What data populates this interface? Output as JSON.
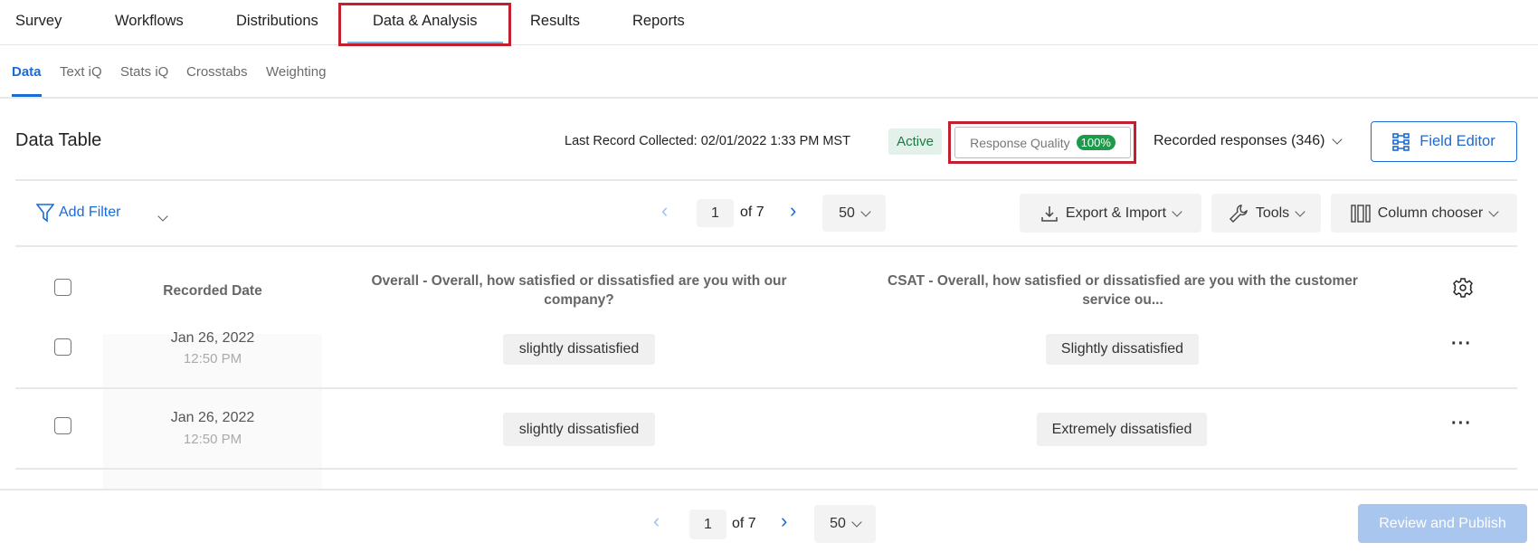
{
  "nav": {
    "tabs": [
      "Survey",
      "Workflows",
      "Distributions",
      "Data & Analysis",
      "Results",
      "Reports"
    ],
    "active": "Data & Analysis"
  },
  "subtabs": {
    "items": [
      "Data",
      "Text iQ",
      "Stats iQ",
      "Crosstabs",
      "Weighting"
    ],
    "active": "Data"
  },
  "header": {
    "title": "Data Table",
    "last_record": "Last Record Collected: 02/01/2022 1:33 PM MST",
    "status": "Active",
    "response_quality_label": "Response Quality",
    "response_quality_value": "100%",
    "recorded_responses": "Recorded responses (346)",
    "field_editor": "Field Editor"
  },
  "toolbar": {
    "add_filter": "Add Filter",
    "page": "1",
    "of_pages": "of 7",
    "page_size": "50",
    "export_import": "Export & Import",
    "tools": "Tools",
    "column_chooser": "Column chooser"
  },
  "table": {
    "columns": [
      "Recorded Date",
      "Overall - Overall, how satisfied or dissatisfied are you with our company?",
      "CSAT - Overall, how satisfied or dissatisfied are you with the customer service ou..."
    ],
    "rows": [
      {
        "date": "Jan 26, 2022",
        "time": "12:50 PM",
        "overall": "slightly dissatisfied",
        "csat": "Slightly dissatisfied"
      },
      {
        "date": "Jan 26, 2022",
        "time": "12:50 PM",
        "overall": "slightly dissatisfied",
        "csat": "Extremely dissatisfied"
      }
    ]
  },
  "footer": {
    "page": "1",
    "of_pages": "of 7",
    "page_size": "50",
    "review_publish": "Review and Publish"
  },
  "colors": {
    "accent": "#1a6bd6",
    "highlight": "#c2202e",
    "active_badge_bg": "#e3f1ea",
    "quality_badge": "#1e9b4a",
    "publish_disabled": "#a9c6ee"
  }
}
